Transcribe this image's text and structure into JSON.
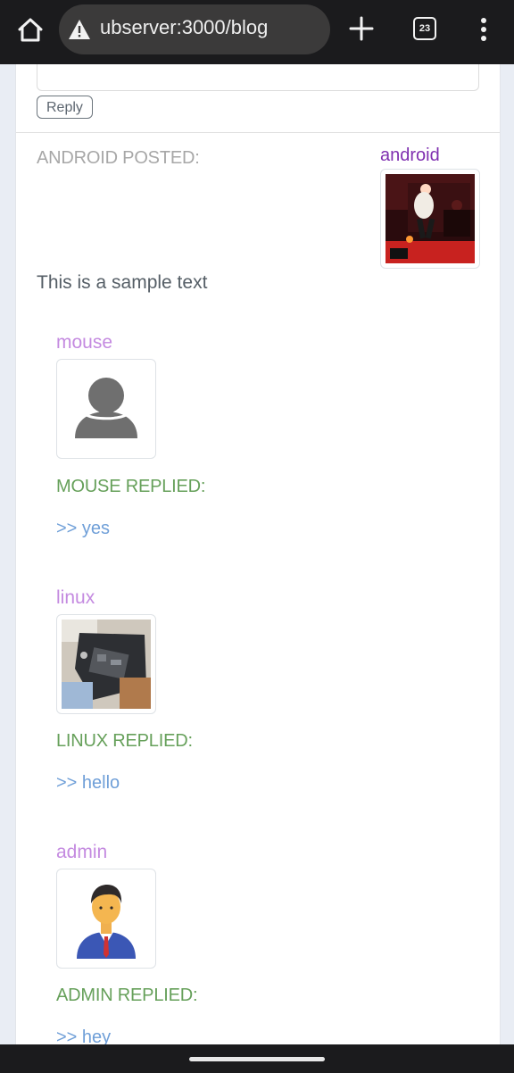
{
  "browser": {
    "url": "ubserver:3000/blog",
    "tab_count": "23",
    "icons": [
      "home-icon",
      "not-secure-warning-icon",
      "plus-icon",
      "tabs-icon",
      "more-vert-icon"
    ]
  },
  "previous_reply": {
    "reply_button": "Reply"
  },
  "post": {
    "posted_label": "ANDROID POSTED:",
    "author": "android",
    "text": "This is a sample text"
  },
  "replies": [
    {
      "user": "mouse",
      "replied_label": "MOUSE REPLIED:",
      "text": ">> yes",
      "avatar": "default-person-icon"
    },
    {
      "user": "linux",
      "replied_label": "LINUX REPLIED:",
      "text": ">> hello",
      "avatar": "laptop-photo"
    },
    {
      "user": "admin",
      "replied_label": "ADMIN REPLIED:",
      "text": ">> hey",
      "avatar": "businessman-avatar"
    }
  ],
  "colors": {
    "author": "#7f2fb0",
    "reply_user": "#c48ae0",
    "replied_label": "#66a05a",
    "reply_text": "#6f9fd8"
  }
}
